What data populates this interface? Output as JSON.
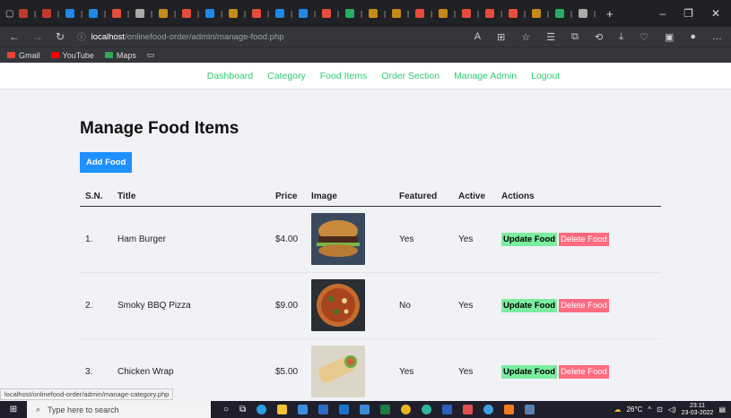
{
  "browser": {
    "tab_icon_colors": [
      "#c0392b",
      "#c0392b",
      "#1e88e5",
      "#1e88e5",
      "#e74c3c",
      "#aaa",
      "#c68a17",
      "#e74c3c",
      "#1e88e5",
      "#c68a17",
      "#e74c3c",
      "#1e88e5",
      "#1e88e5",
      "#e74c3c",
      "#27ae60",
      "#c68a17",
      "#c68a17",
      "#e74c3c",
      "#c68a17",
      "#e74c3c",
      "#e74c3c",
      "#e74c3c",
      "#c68a17",
      "#27ae60",
      "#aaa"
    ],
    "url_host": "localhost",
    "url_path": "/onlinefood-order/admin/manage-food.php",
    "bookmarks": [
      {
        "label": "Gmail",
        "color": "#ea4335"
      },
      {
        "label": "YouTube",
        "color": "#ff0000"
      },
      {
        "label": "Maps",
        "color": "#34a853"
      }
    ],
    "status_url": "localhost/onlinefood-order/admin/manage-category.php"
  },
  "nav": {
    "items": [
      "Dashboard",
      "Category",
      "Food Items",
      "Order Section",
      "Manage Admin",
      "Logout"
    ]
  },
  "page": {
    "title": "Manage Food Items",
    "add_button": "Add Food",
    "columns": [
      "S.N.",
      "Title",
      "Price",
      "Image",
      "Featured",
      "Active",
      "Actions"
    ],
    "rows": [
      {
        "sn": "1.",
        "title": "Ham Burger",
        "price": "$4.00",
        "featured": "Yes",
        "active": "Yes"
      },
      {
        "sn": "2.",
        "title": "Smoky BBQ Pizza",
        "price": "$9.00",
        "featured": "No",
        "active": "Yes"
      },
      {
        "sn": "3.",
        "title": "Chicken Wrap",
        "price": "$5.00",
        "featured": "Yes",
        "active": "Yes"
      }
    ],
    "update_label": "Update Food",
    "delete_label": "Delete Food"
  },
  "taskbar": {
    "search_placeholder": "Type here to search",
    "weather": "26°C",
    "time": "23:11",
    "date": "23-03-2022"
  }
}
